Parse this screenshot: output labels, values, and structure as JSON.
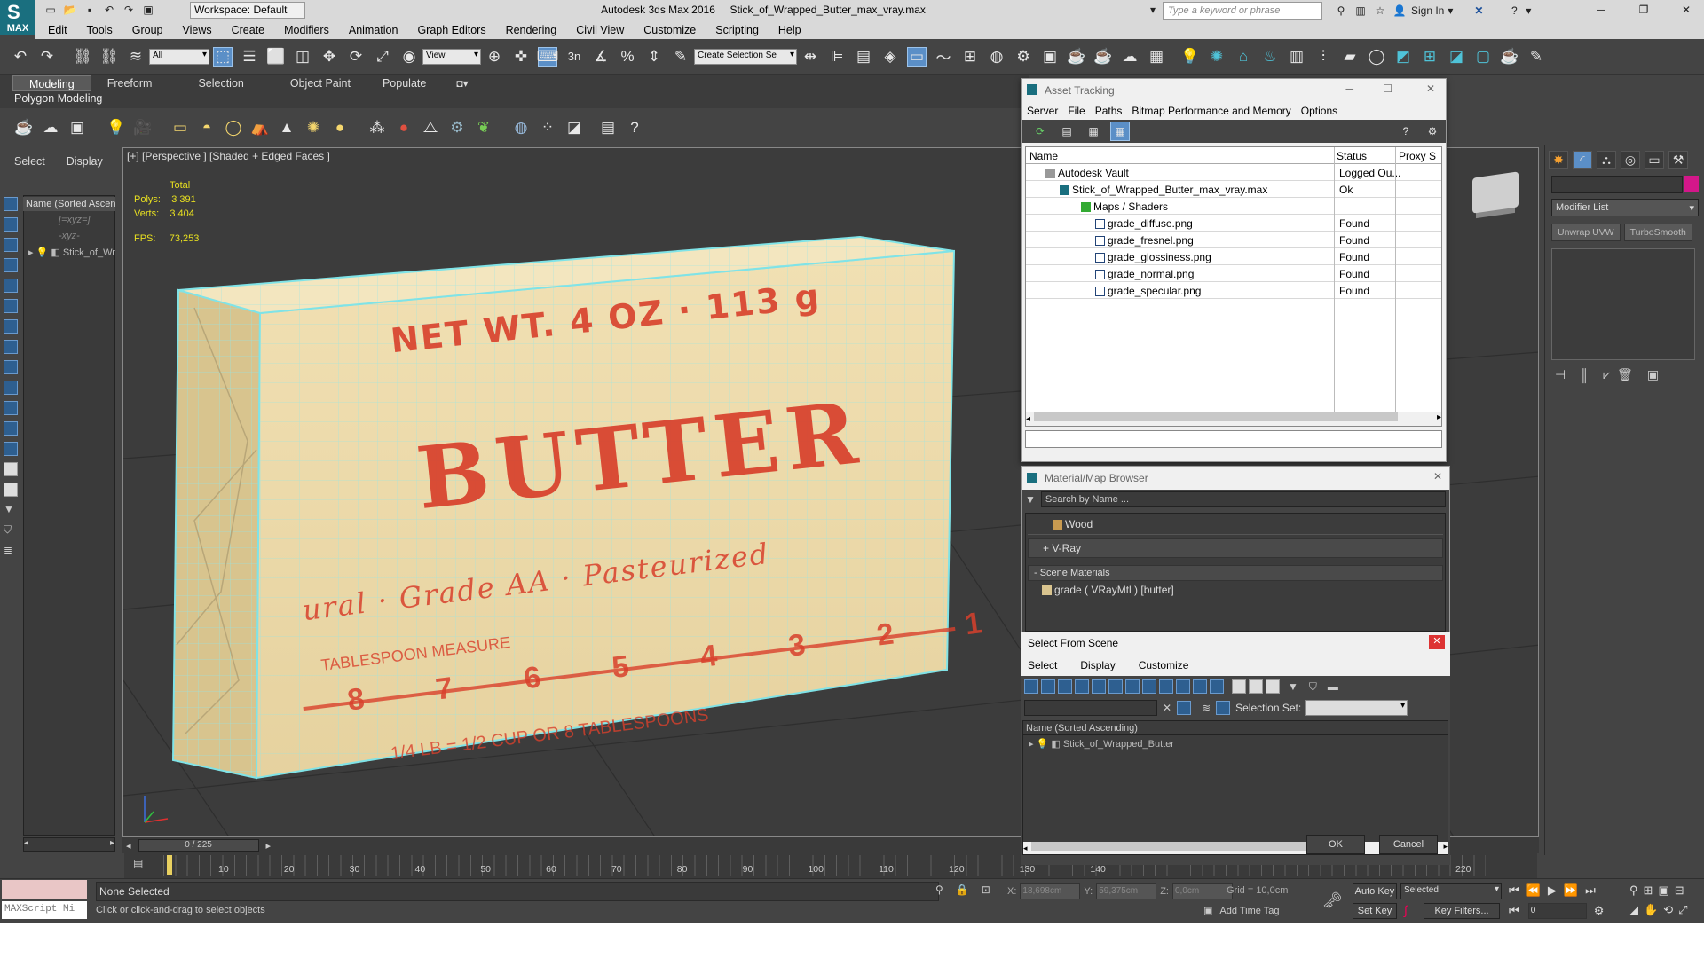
{
  "app": {
    "title": "Autodesk 3ds Max 2016     Stick_of_Wrapped_Butter_max_vray.max",
    "logo": "MAX",
    "workspace": "Workspace: Default",
    "search_placeholder": "Type a keyword or phrase",
    "sign_in": "Sign In"
  },
  "menu": [
    "Edit",
    "Tools",
    "Group",
    "Views",
    "Create",
    "Modifiers",
    "Animation",
    "Graph Editors",
    "Rendering",
    "Civil View",
    "Customize",
    "Scripting",
    "Help"
  ],
  "toolbar": {
    "filter_all": "All",
    "ref_coord": "View",
    "selection_set": "Create Selection Se",
    "snap_label": "3"
  },
  "ribbon": {
    "tabs": [
      "Modeling",
      "Freeform",
      "Selection",
      "Object Paint",
      "Populate"
    ],
    "active_tab": "Modeling",
    "sub_label": "Polygon Modeling"
  },
  "scene_explorer": {
    "tabs": [
      "Select",
      "Display"
    ],
    "header": "Name (Sorted Ascending)",
    "items": [
      "[=xyz=]",
      "-xyz-",
      "Stick_of_Wrapped_Butter"
    ]
  },
  "viewport": {
    "label": "[+] [Perspective ] [Shaded + Edged Faces ]",
    "stats_header": "Total",
    "polys_label": "Polys:",
    "polys": "3 391",
    "verts_label": "Verts:",
    "verts": "3 404",
    "fps_label": "FPS:",
    "fps": "73,253",
    "frame": "0 / 225"
  },
  "butter": {
    "net_wt": "NET WT. 4 OZ · 113 g",
    "brand": "BUTTER",
    "grade": "Sweet Cream · Grade AA · Pasteurized",
    "grade_short": "ural · Grade AA · Pasteurized",
    "tablespoon": "TABLESPOON MEASURE",
    "bottom": "1/4 LB = 1/2 CUP OR 8 TABLESPOONS",
    "numbers": [
      "8",
      "7",
      "6",
      "5",
      "4",
      "3",
      "2",
      "1"
    ]
  },
  "timeline": {
    "ticks": [
      "10",
      "20",
      "30",
      "40",
      "50",
      "60",
      "70",
      "80",
      "90",
      "100",
      "110",
      "120",
      "130",
      "140",
      "220"
    ]
  },
  "status": {
    "none_selected": "None Selected",
    "hint": "Click or click-and-drag to select objects",
    "x": "18,698cm",
    "y": "59,375cm",
    "z": "0,0cm",
    "grid": "Grid = 10,0cm",
    "add_time_tag": "Add Time Tag",
    "auto_key": "Auto Key",
    "auto_key_mode": "Selected",
    "set_key": "Set Key",
    "key_filters": "Key Filters...",
    "frame_field": "0",
    "maxscript": "MAXScript Mi"
  },
  "command_panel": {
    "modifier_list": "Modifier List",
    "buttons": [
      "Unwrap UVW",
      "TurboSmooth"
    ]
  },
  "asset_tracking": {
    "title": "Asset Tracking",
    "menu": [
      "Server",
      "File",
      "Paths",
      "Bitmap Performance and Memory",
      "Options"
    ],
    "columns": [
      "Name",
      "Status",
      "Proxy S"
    ],
    "rows": [
      {
        "name": "Autodesk Vault",
        "status": "Logged Ou..."
      },
      {
        "name": "Stick_of_Wrapped_Butter_max_vray.max",
        "status": "Ok"
      },
      {
        "name": "Maps / Shaders",
        "status": ""
      },
      {
        "name": "grade_diffuse.png",
        "status": "Found"
      },
      {
        "name": "grade_fresnel.png",
        "status": "Found"
      },
      {
        "name": "grade_glossiness.png",
        "status": "Found"
      },
      {
        "name": "grade_normal.png",
        "status": "Found"
      },
      {
        "name": "grade_specular.png",
        "status": "Found"
      }
    ]
  },
  "material_browser": {
    "title": "Material/Map Browser",
    "search_placeholder": "Search by Name ...",
    "wood": "Wood",
    "vray": "+ V-Ray",
    "scene_materials": "- Scene Materials",
    "material": "grade  ( VRayMtl ) [butter]"
  },
  "select_from_scene": {
    "title": "Select From Scene",
    "menu": [
      "Select",
      "Display",
      "Customize"
    ],
    "selection_set_label": "Selection Set:",
    "header": "Name (Sorted Ascending)",
    "item": "Stick_of_Wrapped_Butter",
    "ok": "OK",
    "cancel": "Cancel"
  },
  "colors": {
    "accent": "#5b8fc7",
    "butter": "#ecd9a5",
    "print": "#d8402c",
    "wire": "#7fe3e7"
  }
}
